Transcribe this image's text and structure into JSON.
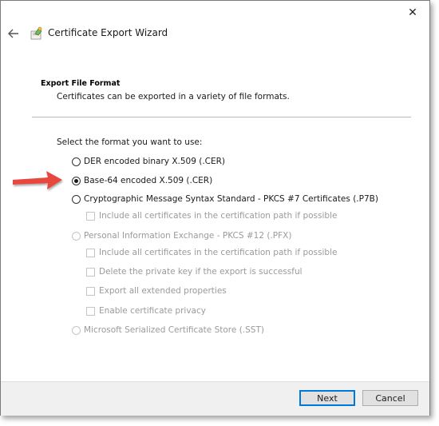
{
  "window": {
    "title": "Certificate Export Wizard",
    "close_glyph": "✕",
    "back_glyph": "←"
  },
  "section": {
    "title": "Export File Format",
    "subtitle": "Certificates can be exported in a variety of file formats."
  },
  "prompt": "Select the format you want to use:",
  "options": [
    {
      "label": "DER encoded binary X.509 (.CER)",
      "selected": false,
      "enabled": true
    },
    {
      "label": "Base-64 encoded X.509 (.CER)",
      "selected": true,
      "enabled": true
    },
    {
      "label": "Cryptographic Message Syntax Standard - PKCS #7 Certificates (.P7B)",
      "selected": false,
      "enabled": true
    },
    {
      "label": "Personal Information Exchange - PKCS #12 (.PFX)",
      "selected": false,
      "enabled": false
    },
    {
      "label": "Microsoft Serialized Certificate Store (.SST)",
      "selected": false,
      "enabled": false
    }
  ],
  "p7b_checks": [
    {
      "label": "Include all certificates in the certification path if possible",
      "checked": false,
      "enabled": false
    }
  ],
  "pfx_checks": [
    {
      "label": "Include all certificates in the certification path if possible",
      "checked": false,
      "enabled": false
    },
    {
      "label": "Delete the private key if the export is successful",
      "checked": false,
      "enabled": false
    },
    {
      "label": "Export all extended properties",
      "checked": false,
      "enabled": false
    },
    {
      "label": "Enable certificate privacy",
      "checked": false,
      "enabled": false
    }
  ],
  "buttons": {
    "next": "Next",
    "cancel": "Cancel"
  },
  "colors": {
    "annotation_arrow": "#e8463c",
    "primary_button_border": "#0078d7",
    "footer_bg": "#f0f0f0"
  },
  "icons": {
    "wizard": "certificate-wizard-icon",
    "back": "back-arrow-icon",
    "close": "close-icon",
    "annotation": "red-arrow-annotation-icon"
  }
}
